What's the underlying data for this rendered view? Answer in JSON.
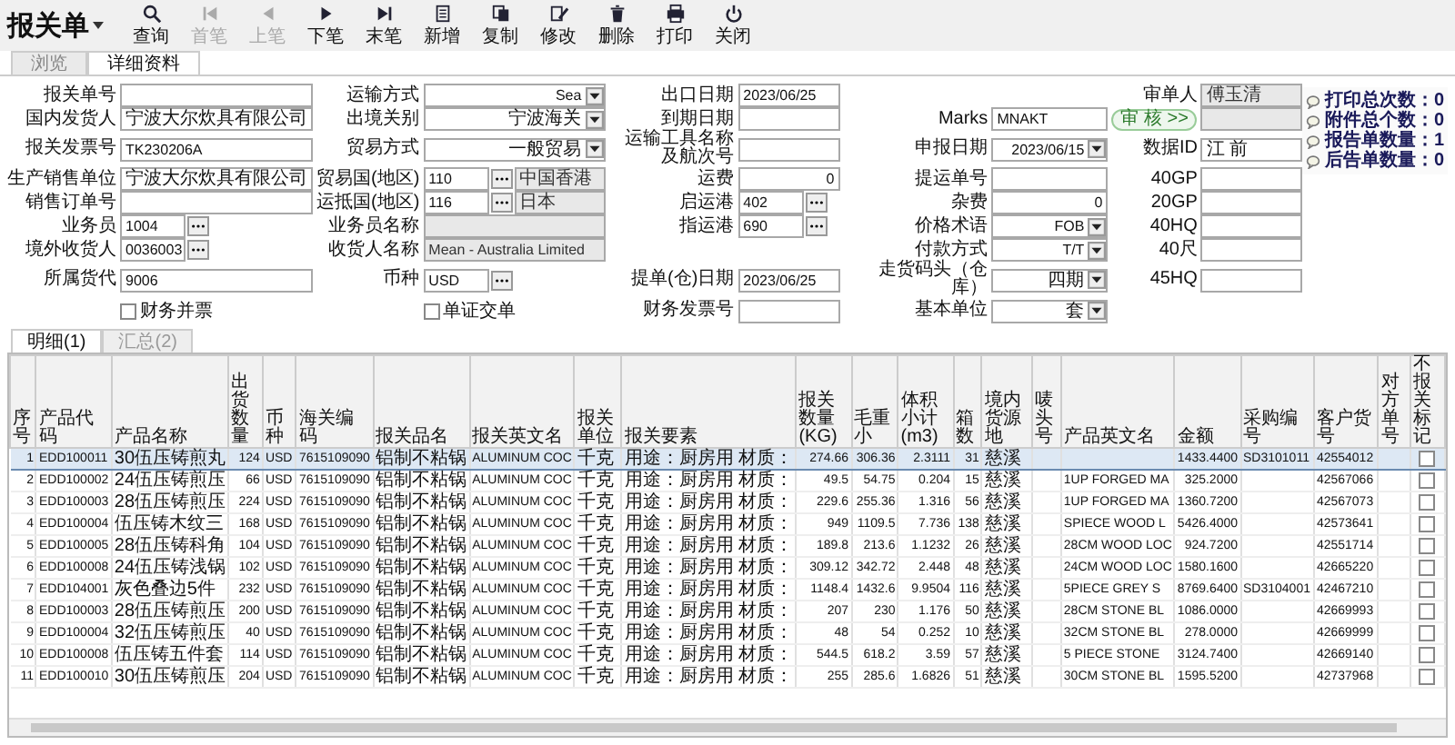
{
  "title": "报关单",
  "toolbar": [
    {
      "label": "查询",
      "disabled": false
    },
    {
      "label": "首笔",
      "disabled": true
    },
    {
      "label": "上笔",
      "disabled": true
    },
    {
      "label": "下笔",
      "disabled": false
    },
    {
      "label": "末笔",
      "disabled": false
    },
    {
      "label": "新增",
      "disabled": false
    },
    {
      "label": "复制",
      "disabled": false
    },
    {
      "label": "修改",
      "disabled": false
    },
    {
      "label": "删除",
      "disabled": false
    },
    {
      "label": "打印",
      "disabled": false
    },
    {
      "label": "关闭",
      "disabled": false
    }
  ],
  "tabs": [
    {
      "label": "浏览",
      "selected": false
    },
    {
      "label": "详细资料",
      "selected": true
    }
  ],
  "form_rows": [
    [
      {
        "label": "报关单号",
        "kind": "text"
      },
      {
        "label": "运输方式",
        "kind": "select",
        "value": "Sea"
      },
      {
        "label": "出口日期",
        "kind": "text",
        "value": "2023/06/25"
      },
      null,
      {
        "label": "审单人",
        "kind": "grey",
        "value": "傅玉清"
      }
    ],
    [
      {
        "label": "国内发货人",
        "kind": "text",
        "value": "宁波大尔炊具有限公司"
      },
      {
        "label": "出境关别",
        "kind": "select",
        "value": "宁波海关"
      },
      {
        "label": "到期日期",
        "kind": "text"
      },
      {
        "label": "Marks",
        "kind": "text",
        "value": "MNAKT"
      },
      {
        "label": "审 核 >>",
        "kind": "button"
      }
    ],
    [
      {
        "label": "报关发票号",
        "kind": "text",
        "value": "TK230206A"
      },
      {
        "label": "贸易方式",
        "kind": "select",
        "value": "一般贸易"
      },
      {
        "label": "运输工具名称及航次号",
        "kind": "text"
      },
      {
        "label": "申报日期",
        "kind": "select",
        "value": "2023/06/15"
      },
      {
        "label": "数据ID",
        "kind": "text",
        "value": "江 前"
      }
    ],
    [
      {
        "label": "生产销售单位",
        "kind": "text",
        "value": "宁波大尔炊具有限公司"
      },
      {
        "label": "贸易国(地区)",
        "kind": "lookup",
        "value": "110",
        "name": "中国香港"
      },
      {
        "label": "运费",
        "kind": "number",
        "value": "0"
      },
      {
        "label": "提运单号",
        "kind": "text"
      },
      {
        "label": "40GP",
        "kind": "text"
      }
    ],
    [
      {
        "label": "销售订单号",
        "kind": "text"
      },
      {
        "label": "运抵国(地区)",
        "kind": "lookup",
        "value": "116",
        "name": "日本"
      },
      {
        "label": "启运港",
        "kind": "lookup",
        "value": "402"
      },
      {
        "label": "杂费",
        "kind": "number",
        "value": "0"
      },
      {
        "label": "20GP",
        "kind": "text"
      }
    ],
    [
      {
        "label": "业务员",
        "kind": "lookup",
        "value": "1004"
      },
      {
        "label": "业务员名称",
        "kind": "grey"
      },
      {
        "label": "指运港",
        "kind": "lookup",
        "value": "690"
      },
      {
        "label": "价格术语",
        "kind": "select",
        "value": "FOB"
      },
      {
        "label": "40HQ",
        "kind": "text"
      }
    ],
    [
      {
        "label": "境外收货人",
        "kind": "lookup",
        "value": "0036003"
      },
      {
        "label": "收货人名称",
        "kind": "grey",
        "value": "Mean - Australia Limited"
      },
      null,
      {
        "label": "付款方式",
        "kind": "select",
        "value": "T/T"
      },
      {
        "label": "40尺",
        "kind": "text"
      }
    ],
    [
      {
        "label": "所属货代",
        "kind": "text",
        "value": "9006"
      },
      {
        "label": "币种",
        "kind": "lookup",
        "value": "USD"
      },
      {
        "label": "提单(仓)日期",
        "kind": "text",
        "value": "2023/06/25"
      },
      {
        "label": "走货码头（仓库）",
        "kind": "select",
        "value": "四期"
      },
      {
        "label": "45HQ",
        "kind": "text"
      }
    ],
    [
      {
        "label": "财务并票",
        "kind": "check",
        "checked": false
      },
      {
        "label": "单证交单",
        "kind": "check",
        "checked": false
      },
      {
        "label": "财务发票号",
        "kind": "text"
      },
      {
        "label": "基本单位",
        "kind": "select",
        "value": "套"
      },
      null
    ]
  ],
  "info": [
    "打印总次数：0",
    "附件总个数：0",
    "报告单数量：1",
    "后告单数量：0"
  ],
  "subtabs": [
    {
      "label": "明细(1)",
      "selected": true
    },
    {
      "label": "汇总(2)",
      "selected": false
    }
  ],
  "table": {
    "columns": [
      "序号",
      "产品代码",
      "产品名称",
      "出货数量",
      "币种",
      "海关编码",
      "报关品名",
      "报关英文名",
      "报关单位",
      "报关要素",
      "报关数量(KG)",
      "毛重小",
      "体积小计(m3)",
      "箱数",
      "境内货源地",
      "唛头号",
      "产品英文名",
      "金额",
      "采购编号",
      "客户货号",
      "对方单号",
      "不报关标记"
    ],
    "rows": [
      {
        "selected": true,
        "flag": false,
        "cells": [
          "1",
          "EDD100011",
          "30伍压铸煎丸",
          "124",
          "USD",
          "7615109090",
          "铝制不粘锅",
          "ALUMINUM COC",
          "千克",
          "用途：厨房用 材质：",
          "274.66",
          "306.36",
          "2.3111",
          "31",
          "慈溪",
          null,
          null,
          "1433.4400",
          "SD3101011",
          "42554012",
          null
        ]
      },
      {
        "selected": false,
        "flag": false,
        "cells": [
          "2",
          "EDD100002",
          "24伍压铸煎压",
          "66",
          "USD",
          "7615109090",
          "铝制不粘锅",
          "ALUMINUM COC",
          "千克",
          "用途：厨房用 材质：",
          "49.5",
          "54.75",
          "0.204",
          "15",
          "慈溪",
          null,
          "1UP FORGED MA",
          "325.2000",
          null,
          "42567066",
          null
        ]
      },
      {
        "selected": false,
        "flag": false,
        "cells": [
          "3",
          "EDD100003",
          "28伍压铸煎压",
          "224",
          "USD",
          "7615109090",
          "铝制不粘锅",
          "ALUMINUM COC",
          "千克",
          "用途：厨房用 材质：",
          "229.6",
          "255.36",
          "1.316",
          "56",
          "慈溪",
          null,
          "1UP FORGED MA",
          "1360.7200",
          null,
          "42567073",
          null
        ]
      },
      {
        "selected": false,
        "flag": false,
        "cells": [
          "4",
          "EDD100004",
          "伍压铸木纹三",
          "168",
          "USD",
          "7615109090",
          "铝制不粘锅",
          "ALUMINUM COC",
          "千克",
          "用途：厨房用 材质：",
          "949",
          "1109.5",
          "7.736",
          "138",
          "慈溪",
          null,
          "SPIECE WOOD L",
          "5426.4000",
          null,
          "42573641",
          null
        ]
      },
      {
        "selected": false,
        "flag": false,
        "cells": [
          "5",
          "EDD100005",
          "28伍压铸科角",
          "104",
          "USD",
          "7615109090",
          "铝制不粘锅",
          "ALUMINUM COC",
          "千克",
          "用途：厨房用 材质：",
          "189.8",
          "213.6",
          "1.1232",
          "26",
          "慈溪",
          null,
          "28CM WOOD LOC",
          "924.7200",
          null,
          "42551714",
          null
        ]
      },
      {
        "selected": false,
        "flag": false,
        "cells": [
          "6",
          "EDD100008",
          "24伍压铸浅锅",
          "102",
          "USD",
          "7615109090",
          "铝制不粘锅",
          "ALUMINUM COC",
          "千克",
          "用途：厨房用 材质：",
          "309.12",
          "342.72",
          "2.448",
          "48",
          "慈溪",
          null,
          "24CM WOOD LOC",
          "1580.1600",
          null,
          "42665220",
          null
        ]
      },
      {
        "selected": false,
        "flag": false,
        "cells": [
          "7",
          "EDD104001",
          "灰色叠边5件",
          "232",
          "USD",
          "7615109090",
          "铝制不粘锅",
          "ALUMINUM COC",
          "千克",
          "用途：厨房用 材质：",
          "1148.4",
          "1432.6",
          "9.9504",
          "116",
          "慈溪",
          null,
          "5PIECE GREY S",
          "8769.6400",
          "SD3104001",
          "42467210",
          null
        ]
      },
      {
        "selected": false,
        "flag": false,
        "cells": [
          "8",
          "EDD100003",
          "28伍压铸煎压",
          "200",
          "USD",
          "7615109090",
          "铝制不粘锅",
          "ALUMINUM COC",
          "千克",
          "用途：厨房用 材质：",
          "207",
          "230",
          "1.176",
          "50",
          "慈溪",
          null,
          "28CM STONE BL",
          "1086.0000",
          null,
          "42669993",
          null
        ]
      },
      {
        "selected": false,
        "flag": false,
        "cells": [
          "9",
          "EDD100004",
          "32伍压铸煎压",
          "40",
          "USD",
          "7615109090",
          "铝制不粘锅",
          "ALUMINUM COC",
          "千克",
          "用途：厨房用 材质：",
          "48",
          "54",
          "0.252",
          "10",
          "慈溪",
          null,
          "32CM STONE BL",
          "278.0000",
          null,
          "42669999",
          null
        ]
      },
      {
        "selected": false,
        "flag": false,
        "cells": [
          "10",
          "EDD100008",
          "伍压铸五件套",
          "114",
          "USD",
          "7615109090",
          "铝制不粘锅",
          "ALUMINUM COC",
          "千克",
          "用途：厨房用 材质：",
          "544.5",
          "618.2",
          "3.59",
          "57",
          "慈溪",
          null,
          "5 PIECE STONE",
          "3124.7400",
          null,
          "42669140",
          null
        ]
      },
      {
        "selected": false,
        "flag": false,
        "cells": [
          "11",
          "EDD100010",
          "30伍压铸煎压",
          "204",
          "USD",
          "7615109090",
          "铝制不粘锅",
          "ALUMINUM COC",
          "千克",
          "用途：厨房用 材质：",
          "255",
          "285.6",
          "1.6826",
          "51",
          "慈溪",
          null,
          "30CM STONE BL",
          "1595.5200",
          null,
          "42737968",
          null
        ]
      }
    ]
  }
}
